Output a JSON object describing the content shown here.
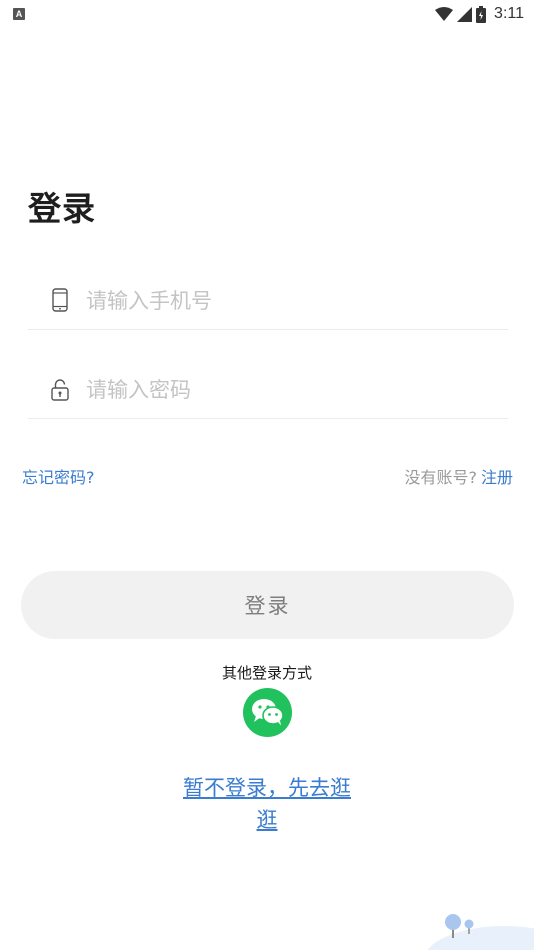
{
  "status_bar": {
    "app_icon_letter": "A",
    "time": "3:11",
    "icons": [
      "wifi-icon",
      "signal-icon",
      "battery-icon"
    ]
  },
  "login": {
    "title": "登录",
    "phone_placeholder": "请输入手机号",
    "password_placeholder": "请输入密码",
    "forgot_label": "忘记密码?",
    "no_account_label": "没有账号?",
    "register_label": "注册",
    "login_button_label": "登录",
    "other_methods_label": "其他登录方式",
    "wechat_icon": "wechat-icon",
    "skip_label": "暂不登录，先去逛逛"
  },
  "colors": {
    "accent": "#3a7ccf",
    "wechat": "#21c15d",
    "button_bg": "#f1f1f1"
  }
}
